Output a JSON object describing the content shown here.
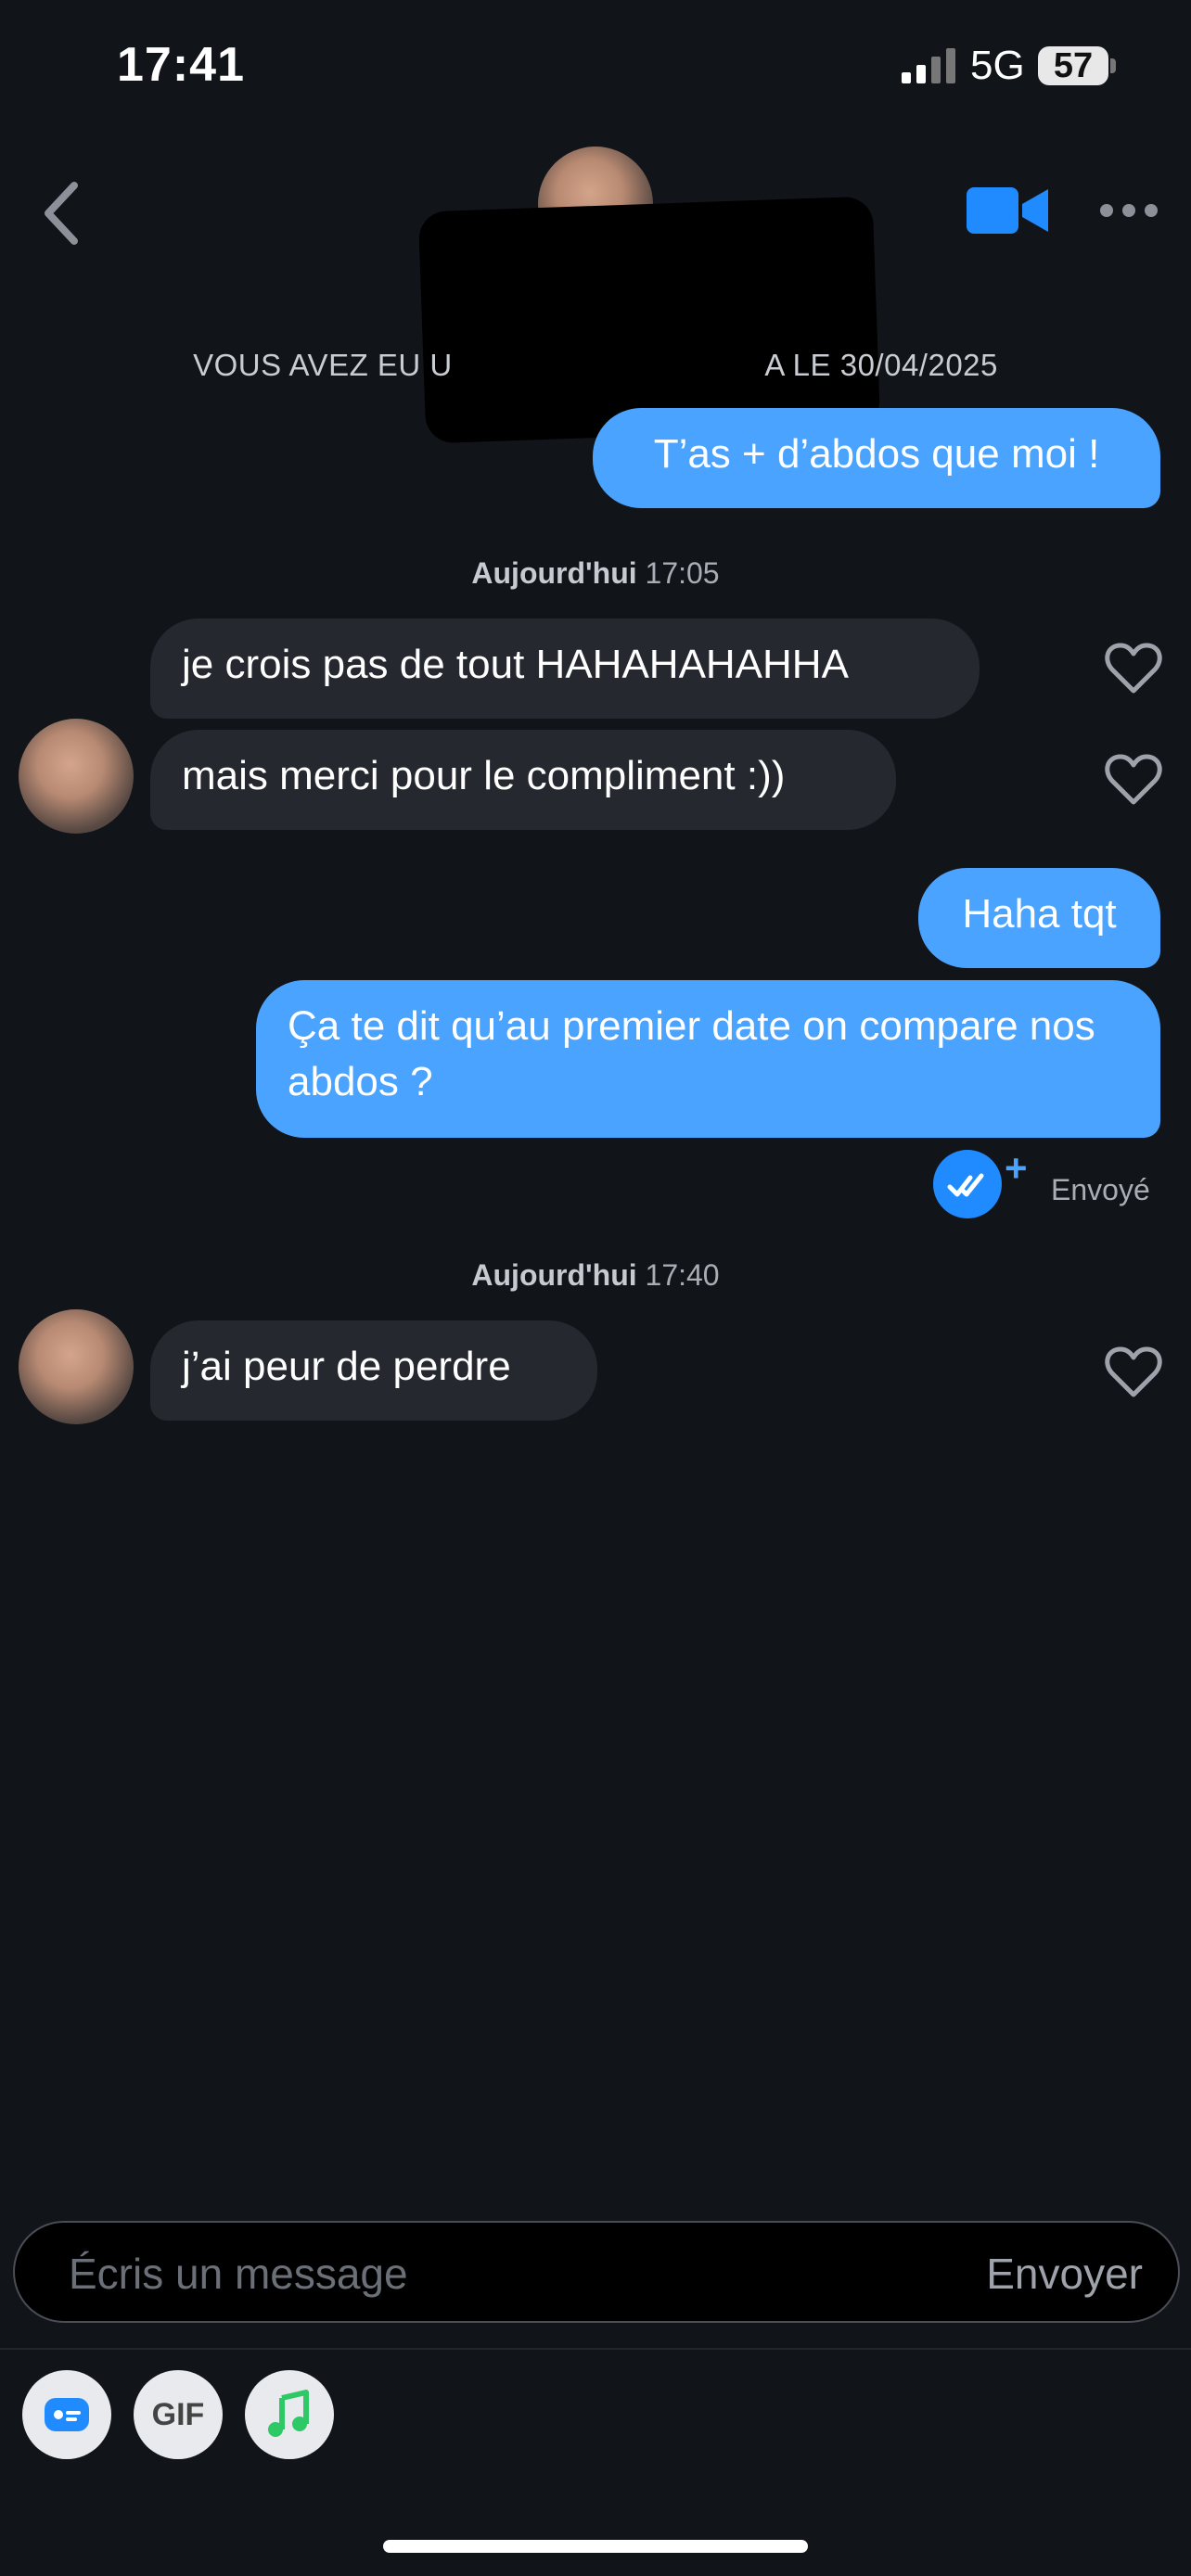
{
  "status_bar": {
    "time": "17:41",
    "network": "5G",
    "battery": "57"
  },
  "header": {
    "back_icon": "chevron-left-icon",
    "video_icon": "video-camera-icon",
    "more_icon": "ellipsis-icon"
  },
  "match_notice": "VOUS AVEZ EU U                                   A LE 30/04/2025",
  "messages": [
    {
      "from": "me",
      "text": "T’as + d’abdos que moi !"
    },
    {
      "type": "stamp",
      "day": "Aujourd'hui",
      "time": "17:05"
    },
    {
      "from": "them",
      "text": "je crois pas de tout HAHAHAHAHHA"
    },
    {
      "from": "them",
      "text": "mais merci pour le compliment :))"
    },
    {
      "from": "me",
      "text": "Haha tqt"
    },
    {
      "from": "me",
      "text": "Ça te dit qu’au premier date on compare nos abdos ?"
    },
    {
      "type": "stamp",
      "day": "Aujourd'hui",
      "time": "17:40"
    },
    {
      "from": "them",
      "text": "j’ai peur de perdre"
    }
  ],
  "read_receipt": {
    "label": "Envoyé",
    "plus": "+"
  },
  "composer": {
    "placeholder": "Écris un message",
    "send_label": "Envoyer"
  },
  "toolbar": {
    "gif_label": "GIF"
  },
  "colors": {
    "background": "#111419",
    "my_bubble": "#4aa3ff",
    "their_bubble": "#25282f",
    "accent": "#1f8bff"
  }
}
